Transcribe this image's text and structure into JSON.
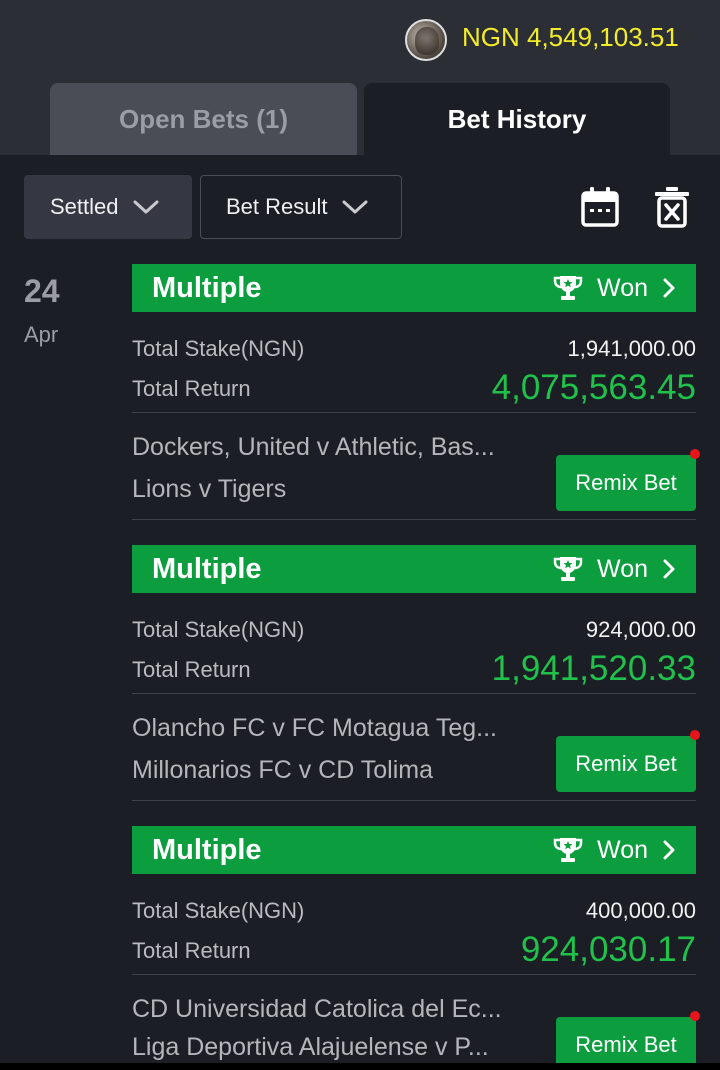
{
  "header": {
    "balance": "NGN 4,549,103.51"
  },
  "tabs": [
    {
      "label": "Open Bets (1)"
    },
    {
      "label": "Bet History"
    }
  ],
  "filters": {
    "status": "Settled",
    "result": "Bet Result"
  },
  "date": {
    "day": "24",
    "month": "Apr"
  },
  "bets": [
    {
      "type": "Multiple",
      "status": "Won",
      "stake_label": "Total Stake(NGN)",
      "stake": "1,941,000.00",
      "return_label": "Total Return",
      "return": "4,075,563.45",
      "line1": "Dockers, United v Athletic, Bas...",
      "line2": "Lions v Tigers",
      "remix_label": "Remix Bet"
    },
    {
      "type": "Multiple",
      "status": "Won",
      "stake_label": "Total Stake(NGN)",
      "stake": "924,000.00",
      "return_label": "Total Return",
      "return": "1,941,520.33",
      "line1": "Olancho FC v FC Motagua Teg...",
      "line2": "Millonarios FC v CD Tolima",
      "remix_label": "Remix Bet"
    },
    {
      "type": "Multiple",
      "status": "Won",
      "stake_label": "Total Stake(NGN)",
      "stake": "400,000.00",
      "return_label": "Total Return",
      "return": "924,030.17",
      "line1": "CD Universidad Catolica del Ec...",
      "line2": "Liga Deportiva Alajuelense v P...",
      "remix_label": "Remix Bet"
    }
  ],
  "colors": {
    "accent_green": "#0c9e3e",
    "return_green": "#20c24b",
    "balance_yellow": "#f3ec2b",
    "notification_red": "#e8141c"
  }
}
